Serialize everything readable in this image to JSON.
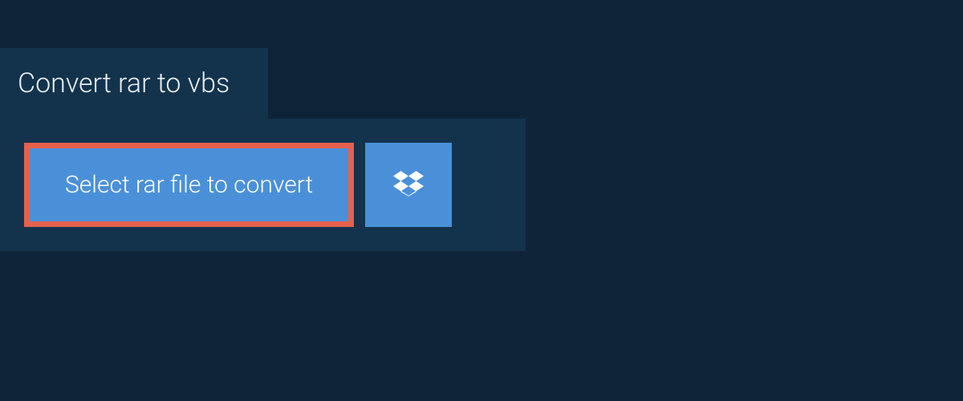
{
  "header": {
    "title": "Convert rar to vbs"
  },
  "actions": {
    "select_file_label": "Select rar file to convert"
  }
}
